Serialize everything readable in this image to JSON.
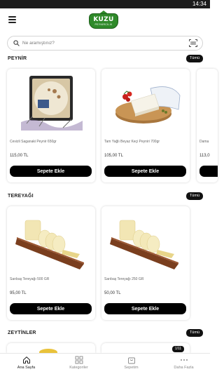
{
  "status_bar": {
    "time": "14:34"
  },
  "header": {
    "logo_brand": "KUZU",
    "logo_sub": "PEYNİRCİLİK"
  },
  "search": {
    "placeholder": "Ne aramıştınız?"
  },
  "sections": [
    {
      "title": "PEYNİR",
      "see_all": "Tümü",
      "products": [
        {
          "name": "Cevizli Saganaki Peynir 650gr",
          "price": "115,00 TL",
          "button": "Sepete Ekle"
        },
        {
          "name": "Tam Yağlı Beyaz Keçi Peyniri 700gr",
          "price": "105,00 TL",
          "button": "Sepete Ekle"
        },
        {
          "name": "Dama",
          "price": "113,0"
        }
      ]
    },
    {
      "title": "TEREYAĞI",
      "see_all": "Tümü",
      "products": [
        {
          "name": "Sarıbaş Tereyağı 500 GR",
          "price": "95,00 TL",
          "button": "Sepete Ekle"
        },
        {
          "name": "Sarıbaş Tereyağı 250 GR",
          "price": "50,00 TL",
          "button": "Sepete Ekle"
        }
      ]
    },
    {
      "title": "ZEYTİNLER",
      "see_all": "Tümü"
    }
  ],
  "badge": "1/11",
  "bottom_nav": [
    {
      "label": "Ana Sayfa",
      "icon": "home-icon"
    },
    {
      "label": "Kategoriler",
      "icon": "grid-icon"
    },
    {
      "label": "Sepetim",
      "icon": "cart-icon"
    },
    {
      "label": "Daha Fazla",
      "icon": "more-icon"
    }
  ],
  "colors": {
    "accent": "#000000",
    "brand_green": "#2f8a2a",
    "status_bar": "#1c1c1c"
  }
}
